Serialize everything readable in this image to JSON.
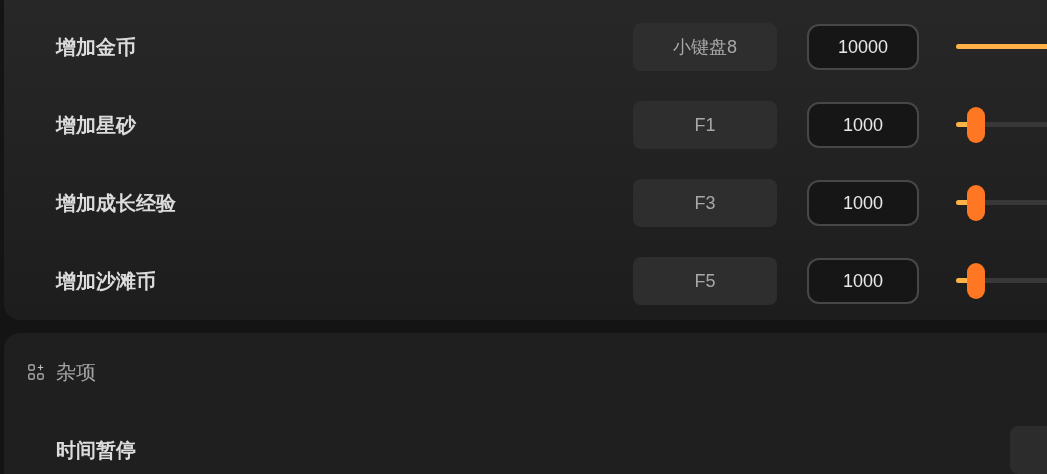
{
  "hotkey_section": {
    "rows": [
      {
        "label": "增加金币",
        "hotkey": "小键盘8",
        "value": "10000",
        "level": 1
      },
      {
        "label": "增加星砂",
        "hotkey": "F1",
        "value": "1000",
        "level": 0.22
      },
      {
        "label": "增加成长经验",
        "hotkey": "F3",
        "value": "1000",
        "level": 0.22
      },
      {
        "label": "增加沙滩币",
        "hotkey": "F5",
        "value": "1000",
        "level": 0.22
      }
    ]
  },
  "misc_section": {
    "title": "杂项",
    "rows": [
      {
        "label": "时间暂停"
      }
    ]
  }
}
